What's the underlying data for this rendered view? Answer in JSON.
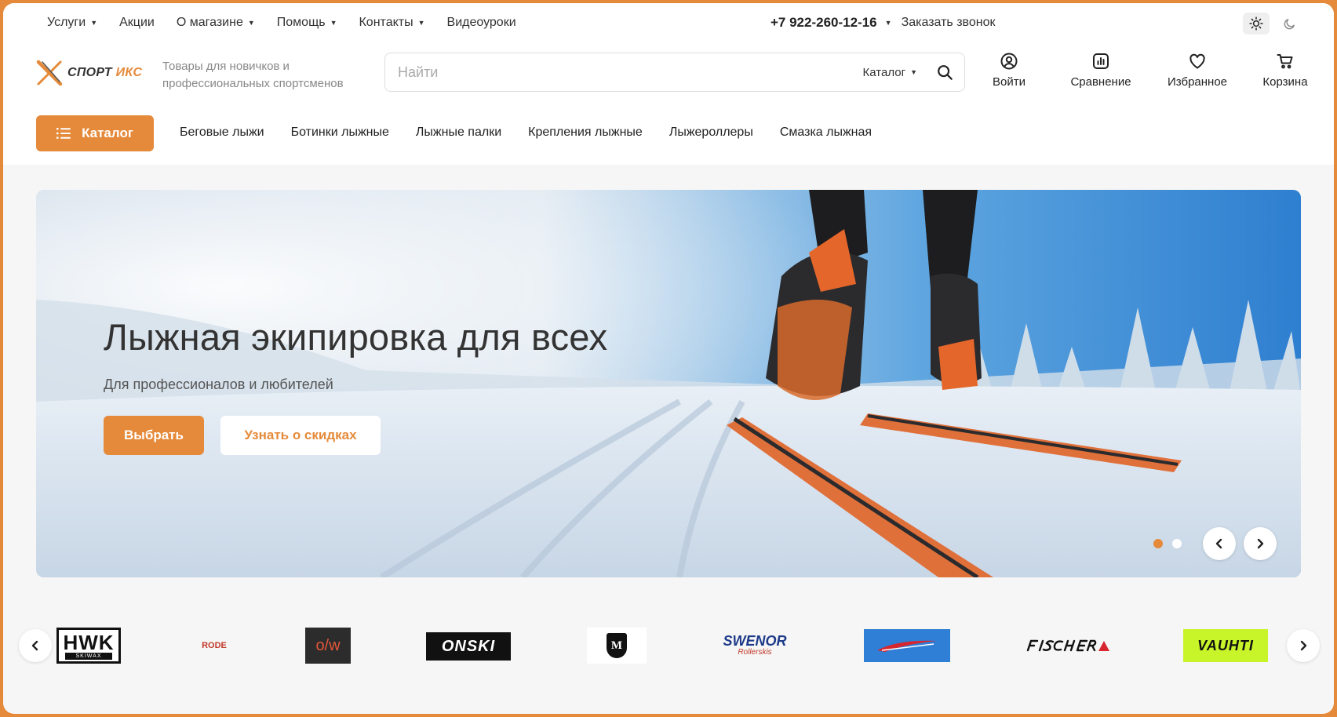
{
  "topbar": {
    "nav": [
      {
        "label": "Услуги",
        "dropdown": true
      },
      {
        "label": "Акции",
        "dropdown": false
      },
      {
        "label": "О магазине",
        "dropdown": true
      },
      {
        "label": "Помощь",
        "dropdown": true
      },
      {
        "label": "Контакты",
        "dropdown": true
      },
      {
        "label": "Видеоуроки",
        "dropdown": false
      }
    ],
    "phone": "+7 922-260-12-16",
    "callback": "Заказать звонок"
  },
  "header": {
    "logo": {
      "prefix": "СПОРТ",
      "accent": "ИКС"
    },
    "tagline": "Товары для новичков и профессиональных спортсменов",
    "search": {
      "placeholder": "Найти",
      "category": "Каталог"
    },
    "actions": {
      "login": "Войти",
      "compare": "Сравнение",
      "favorites": "Избранное",
      "cart": "Корзина"
    }
  },
  "catalog": {
    "button": "Каталог",
    "links": [
      "Беговые лыжи",
      "Ботинки лыжные",
      "Лыжные палки",
      "Крепления лыжные",
      "Лыжероллеры",
      "Смазка лыжная"
    ]
  },
  "banner": {
    "title": "Лыжная экипировка для всех",
    "subtitle": "Для профессионалов и любителей",
    "primary_button": "Выбрать",
    "secondary_button": "Узнать о скидках",
    "slides_total": 2,
    "active_slide": 1
  },
  "brands": {
    "hwk": {
      "main": "HWK",
      "sub": "SKIWAX"
    },
    "rode": "RODE",
    "ow": "o/w",
    "onski": "ONSKI",
    "madshus": "M",
    "swenor": {
      "main": "SWENOR",
      "sub": "Rollerskis"
    },
    "vauhti": "VAUHTI"
  },
  "colors": {
    "accent": "#e58a3a",
    "text": "#222222",
    "muted": "#888888",
    "frame": "#e58a3a"
  }
}
